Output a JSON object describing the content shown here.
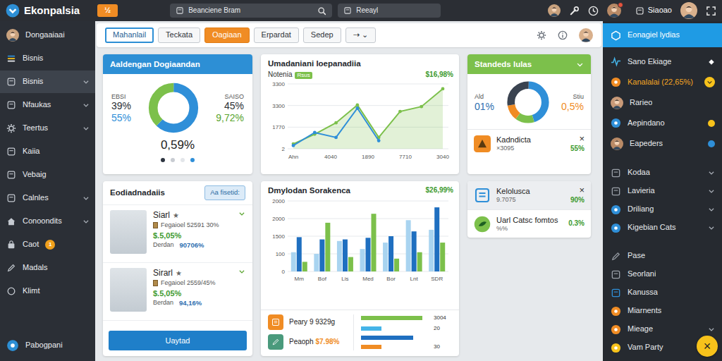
{
  "app": {
    "title": "Ekonpalsia",
    "badge": "½"
  },
  "header_fields": [
    {
      "value": "Beanciene Bram"
    },
    {
      "value": "Reeayl"
    }
  ],
  "header_user": {
    "name": "Siaoao",
    "alert": true
  },
  "sidebar": {
    "items": [
      {
        "label": "Dongaaiaai",
        "selected": false,
        "expandable": false
      },
      {
        "label": "Bisnis",
        "selected": false,
        "expandable": false
      },
      {
        "label": "Bisnis",
        "selected": true,
        "expandable": true
      },
      {
        "label": "Nfaukas",
        "selected": false,
        "expandable": true
      },
      {
        "label": "Teertus",
        "selected": false,
        "expandable": true
      },
      {
        "label": "Kaiia",
        "selected": false,
        "expandable": false
      },
      {
        "label": "Vebaig",
        "selected": false,
        "expandable": false
      },
      {
        "label": "Calnles",
        "selected": false,
        "expandable": true
      },
      {
        "label": "Conoondits",
        "selected": false,
        "expandable": true
      },
      {
        "label": "Caot",
        "selected": false,
        "expandable": false,
        "badge": "1"
      },
      {
        "label": "Madals",
        "selected": false,
        "expandable": false
      },
      {
        "label": "Klimt",
        "selected": false,
        "expandable": false
      },
      {
        "label": "Pabogpani",
        "selected": false,
        "expandable": false
      }
    ]
  },
  "toolbar": {
    "tabs": [
      {
        "label": "Mahanlail",
        "selected": false,
        "focused": true
      },
      {
        "label": "Teckata",
        "selected": false,
        "focused": false
      },
      {
        "label": "Oagiaan",
        "selected": true,
        "focused": false
      },
      {
        "label": "Erpardat",
        "selected": false,
        "focused": false
      },
      {
        "label": "Sedep",
        "selected": false,
        "focused": false
      },
      {
        "label": "⇢ ⌄",
        "selected": false,
        "focused": false
      }
    ]
  },
  "summary": {
    "title": "Aaldengan Dogiaandan",
    "left": {
      "label": "EBSI",
      "value": "39%",
      "sub": "55%"
    },
    "right": {
      "label": "SAISO",
      "value": "45%",
      "sub": "9,72%"
    },
    "center": "0,59%",
    "segments": [
      {
        "value": 62,
        "color": "#2f8fd8"
      },
      {
        "value": 38,
        "color": "#7cc04b"
      }
    ],
    "pages": [
      {
        "color": "#2d3440"
      },
      {
        "color": "#c8ccd2"
      },
      {
        "color": "#e3e6ea"
      },
      {
        "color": "#2f8fd8"
      }
    ]
  },
  "trend": {
    "title": "Umadaniani loepanadiia",
    "legend": "Notenia",
    "tag": "Rsus",
    "value": "$16,98%",
    "y_max": 4000,
    "y_ticks": [
      "3300",
      "3300",
      "1770",
      "2"
    ],
    "x_ticks": [
      "Ahn",
      "4040",
      "1890",
      "7710",
      "3040"
    ],
    "series": [
      {
        "color": "#7cc04b",
        "area": true,
        "values": [
          300,
          900,
          1600,
          2700,
          700,
          2300,
          2600,
          3700
        ]
      },
      {
        "color": "#2f8fd8",
        "area": false,
        "values": [
          200,
          1000,
          700,
          2500,
          500
        ]
      }
    ]
  },
  "status": {
    "title": "Standeds lulas",
    "left": {
      "label": "Ald",
      "value": "01%"
    },
    "right": {
      "label": "Stiu",
      "value": "0,5%"
    },
    "segments": [
      {
        "value": 45,
        "color": "#2f8fd8"
      },
      {
        "value": 15,
        "color": "#7cc04b"
      },
      {
        "value": 12,
        "color": "#f08c24"
      },
      {
        "value": 28,
        "color": "#3a4350"
      }
    ],
    "item": {
      "title": "Kadndicta",
      "sub": "×3095",
      "value": "55%",
      "close": "×",
      "color": "#f08c24"
    }
  },
  "team": {
    "title": "Eodiadnadaiis",
    "filter": "Aa fisetid:",
    "people": [
      {
        "name": "Siarl",
        "star": "★",
        "detail": "Fegaioel 52591 30%",
        "amount": "$.5,05%",
        "label": "Derdan",
        "pct": "90706%"
      },
      {
        "name": "Sirarl",
        "star": "★",
        "detail": "Fegaioel 2559/45%",
        "amount": "$.5,05%",
        "label": "Berdan",
        "pct": "94,16%"
      }
    ],
    "action": "Uaytad"
  },
  "sales": {
    "title": "Dmylodan Sorakenca",
    "value": "$26,99%",
    "y_max": 2200,
    "y_ticks": [
      "2000",
      "2000",
      "1500",
      "100",
      "0"
    ],
    "x_ticks": [
      "Mm",
      "Bof",
      "Lis",
      "Med",
      "Bor",
      "Lnt",
      "SDR"
    ],
    "series": [
      {
        "color": "#a9d4f0",
        "values": [
          600,
          550,
          950,
          700,
          900,
          1600,
          1300
        ]
      },
      {
        "color": "#1f6fc0",
        "values": [
          1070,
          1000,
          1000,
          1050,
          1100,
          1250,
          2000
        ]
      },
      {
        "color": "#7cc04b",
        "values": [
          300,
          1520,
          450,
          1800,
          400,
          600,
          900
        ]
      }
    ],
    "stats": [
      {
        "label": "Peary 9 9329g",
        "color": "#f08c24"
      },
      {
        "label": "Peaoph",
        "value": "$7.98%",
        "color": "#4a9a7c"
      }
    ],
    "meters": [
      {
        "level": 0.92,
        "color": "#7cc04b",
        "reading": "3004"
      },
      {
        "level": 0.3,
        "color": "#45b4e8",
        "reading": "20"
      },
      {
        "level": 0.78,
        "color": "#1f6fc0"
      },
      {
        "level": 0.3,
        "color": "#f08c24",
        "reading": "30"
      }
    ]
  },
  "alerts": {
    "items": [
      {
        "title": "Kelolusca",
        "sub": "9.7075",
        "value": "90%",
        "close": "×",
        "color": "#2f8fd8",
        "selected": true
      },
      {
        "title": "Uarl Catsc fomtos",
        "sub": "%%",
        "value": "0.3%",
        "color": "#7cc04b",
        "selected": false
      }
    ]
  },
  "panel": {
    "groups": [
      {
        "items": [
          {
            "label": "Eonagiel lydias",
            "kind": "header",
            "selected": true,
            "highlight": false,
            "color": "#ffffff"
          },
          {
            "label": "Sano Ekiage",
            "kind": "mark",
            "selected": false,
            "highlight": false,
            "color": "#45b4e8",
            "mark_color": "#ffffff"
          },
          {
            "label": "Kanalalai (22,65%)",
            "kind": "badge",
            "selected": false,
            "highlight": true,
            "color": "#f08c24",
            "mark_color": "#f7c21b"
          },
          {
            "label": "Rarieo",
            "kind": "plain",
            "selected": false,
            "highlight": false,
            "color": "#c99a78"
          },
          {
            "label": "Aepindano",
            "kind": "dot",
            "selected": false,
            "highlight": false,
            "color": "#2f8fd8",
            "mark_color": "#f7c21b"
          },
          {
            "label": "Eapeders",
            "kind": "dot",
            "selected": false,
            "highlight": false,
            "color": "#b98a66",
            "mark_color": "#2f8fd8"
          }
        ]
      },
      {
        "items": [
          {
            "label": "Kodaa",
            "kind": "fold",
            "selected": false,
            "highlight": false,
            "color": "#9aa0a8"
          },
          {
            "label": "Lavieria",
            "kind": "fold",
            "selected": false,
            "highlight": false,
            "color": "#9aa0a8"
          },
          {
            "label": "Driliang",
            "kind": "fold",
            "selected": false,
            "highlight": false,
            "color": "#2f8fd8"
          },
          {
            "label": "Kigebian Cats",
            "kind": "fold",
            "selected": false,
            "highlight": false,
            "color": "#2f8fd8"
          }
        ]
      },
      {
        "items": [
          {
            "label": "Pase",
            "kind": "plain",
            "selected": false,
            "highlight": false,
            "color": "#9aa0a8"
          },
          {
            "label": "Seorlani",
            "kind": "plain",
            "selected": false,
            "highlight": false,
            "color": "#9aa0a8"
          },
          {
            "label": "Kanussa",
            "kind": "plain",
            "selected": false,
            "highlight": false,
            "color": "#2f8fd8"
          },
          {
            "label": "Miarnents",
            "kind": "plain",
            "selected": false,
            "highlight": false,
            "color": "#f08c24"
          },
          {
            "label": "Mieage",
            "kind": "fold",
            "selected": false,
            "highlight": false,
            "color": "#f08c24"
          },
          {
            "label": "Vam Party",
            "kind": "plain",
            "selected": false,
            "highlight": false,
            "color": "#f7c21b"
          }
        ]
      }
    ],
    "fab": "×"
  }
}
